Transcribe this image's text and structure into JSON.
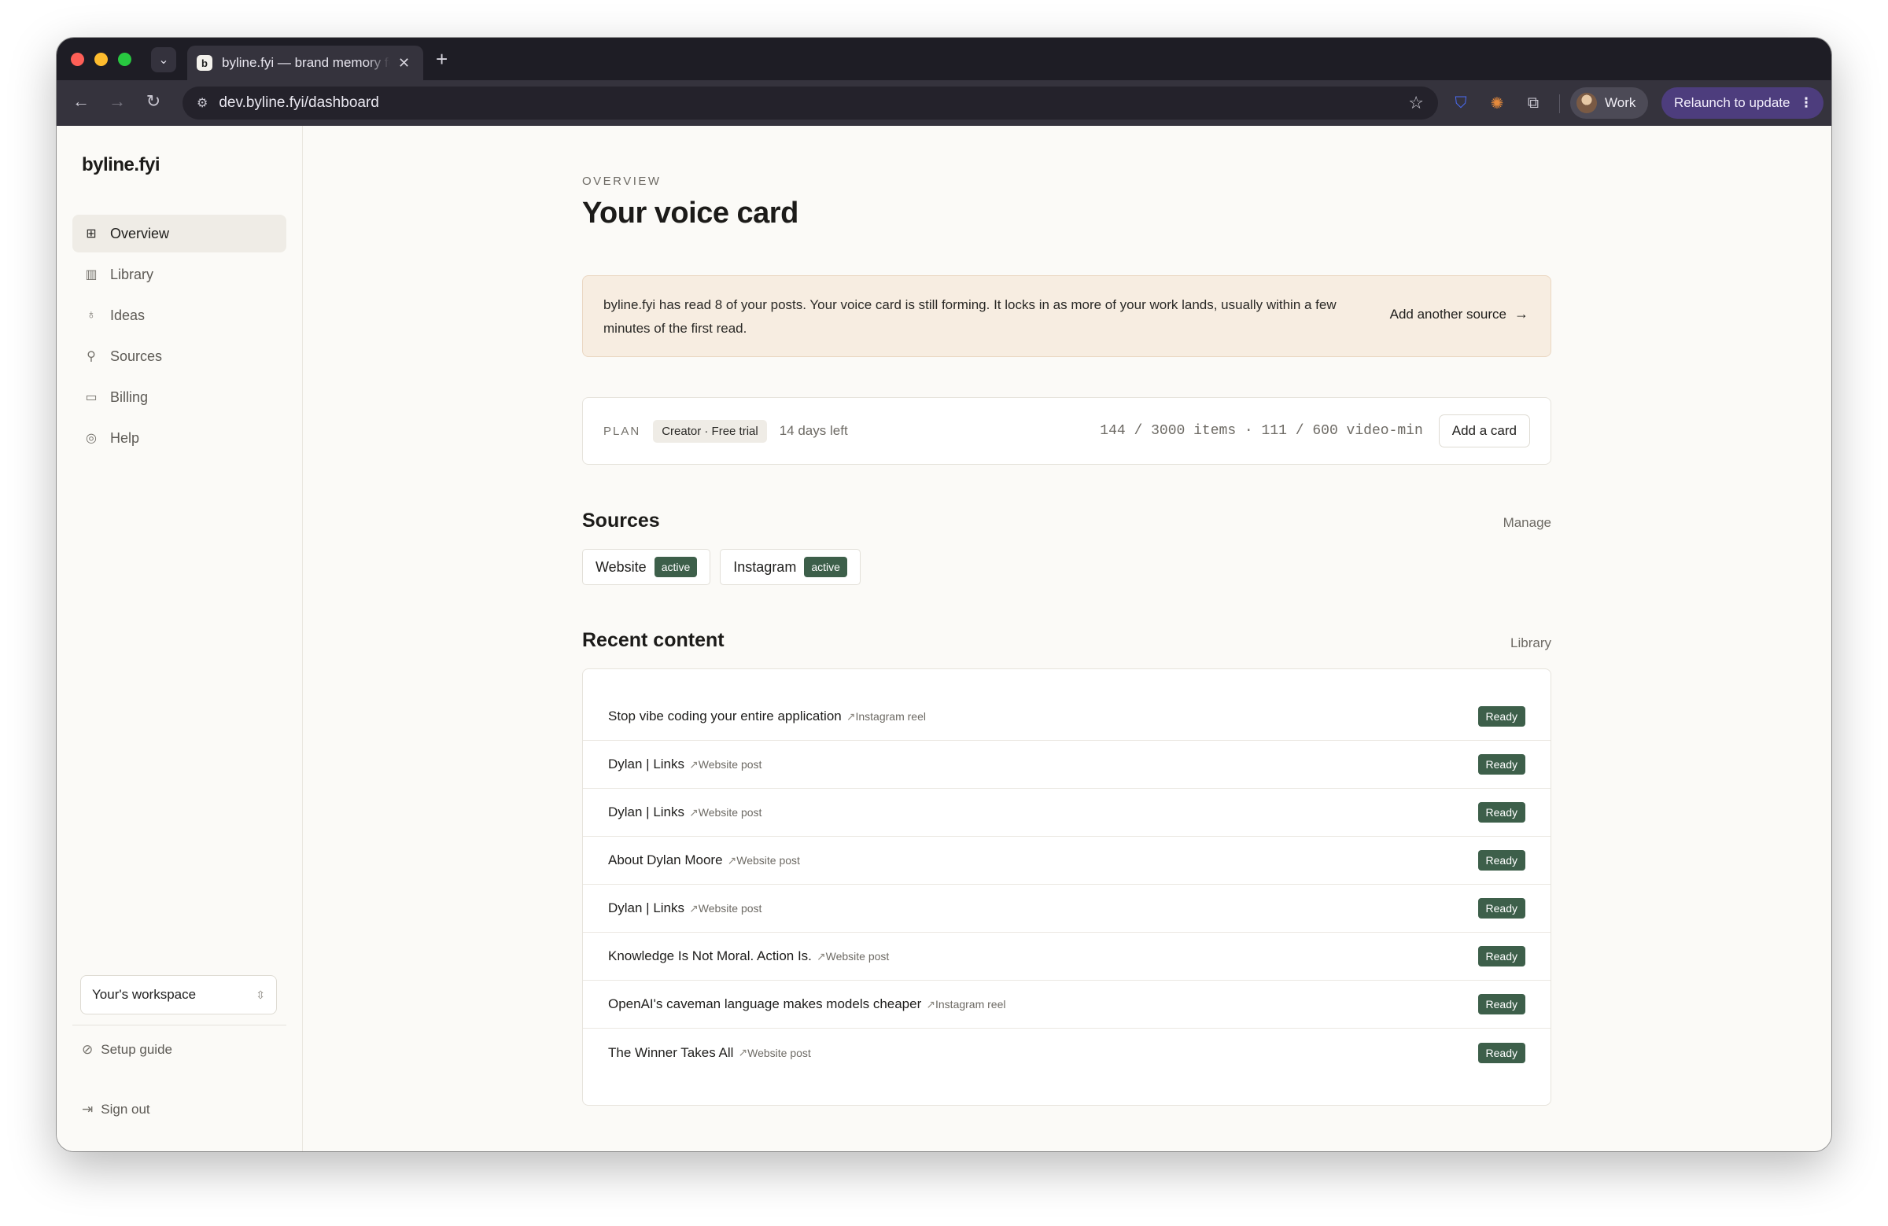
{
  "browser": {
    "tab_title": "byline.fyi — brand memory for creators",
    "tab_favicon": "b",
    "url": "dev.byline.fyi/dashboard",
    "profile": "Work",
    "relaunch": "Relaunch to update"
  },
  "sidebar": {
    "brand": "byline.fyi",
    "items": [
      {
        "label": "Overview",
        "icon": "grid-icon"
      },
      {
        "label": "Library",
        "icon": "books-icon"
      },
      {
        "label": "Ideas",
        "icon": "lightbulb-icon"
      },
      {
        "label": "Sources",
        "icon": "plug-icon"
      },
      {
        "label": "Billing",
        "icon": "card-icon"
      },
      {
        "label": "Help",
        "icon": "lifebuoy-icon"
      }
    ],
    "workspace": "Your's workspace",
    "setup_guide": "Setup guide",
    "sign_out": "Sign out"
  },
  "main": {
    "eyebrow": "OVERVIEW",
    "title": "Your voice card",
    "notice": {
      "text": "byline.fyi has read 8 of your posts. Your voice card is still forming. It locks in as more of your work lands, usually within a few minutes of the first read.",
      "link": "Add another source"
    },
    "plan": {
      "label": "PLAN",
      "badge": "Creator · Free trial",
      "days_left": "14 days left",
      "usage": "144 / 3000 items · 111 / 600 video-min",
      "button": "Add a card"
    },
    "sources": {
      "title": "Sources",
      "manage": "Manage",
      "items": [
        {
          "name": "Website",
          "status": "active"
        },
        {
          "name": "Instagram",
          "status": "active"
        }
      ]
    },
    "recent": {
      "title": "Recent content",
      "library": "Library",
      "rows": [
        {
          "title": "Stop vibe coding your entire application",
          "type": "Instagram reel",
          "status": "Ready"
        },
        {
          "title": "Dylan | Links",
          "type": "Website post",
          "status": "Ready"
        },
        {
          "title": "Dylan | Links",
          "type": "Website post",
          "status": "Ready"
        },
        {
          "title": "About Dylan Moore",
          "type": "Website post",
          "status": "Ready"
        },
        {
          "title": "Dylan | Links",
          "type": "Website post",
          "status": "Ready"
        },
        {
          "title": "Knowledge Is Not Moral. Action Is.",
          "type": "Website post",
          "status": "Ready"
        },
        {
          "title": "OpenAI's caveman language makes models cheaper",
          "type": "Instagram reel",
          "status": "Ready"
        },
        {
          "title": "The Winner Takes All",
          "type": "Website post",
          "status": "Ready"
        }
      ]
    }
  },
  "colors": {
    "accent_green": "#3d5f4a",
    "notice_bg": "#f7ede1",
    "relaunch_purple": "#4d3d7d"
  }
}
